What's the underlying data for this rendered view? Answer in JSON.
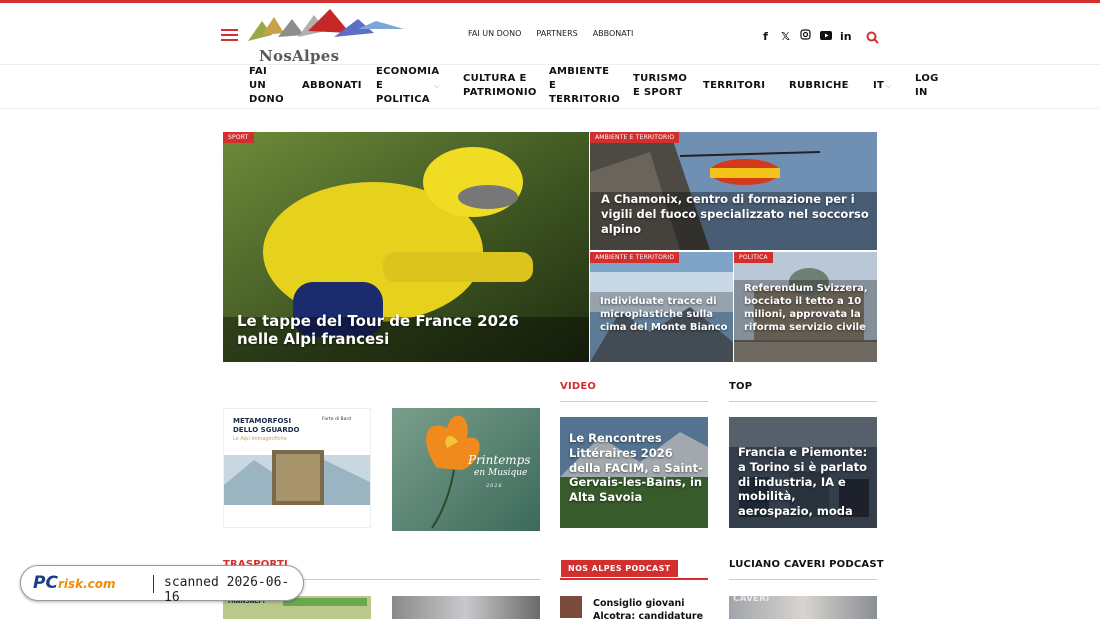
{
  "brand": {
    "name": "NosAlpes",
    "accent": "#d32f2f"
  },
  "toplinks": [
    "FAI UN DONO",
    "PARTNERS",
    "ABBONATI"
  ],
  "social_icons": [
    "facebook-icon",
    "x-icon",
    "instagram-icon",
    "youtube-icon",
    "linkedin-icon"
  ],
  "nav": {
    "fai": [
      "FAI",
      "UN",
      "DONO"
    ],
    "abbonati": "ABBONATI",
    "economia": [
      "ECONOMIA",
      "E",
      "POLITICA"
    ],
    "cultura": [
      "CULTURA E",
      "PATRIMONIO"
    ],
    "ambiente": [
      "AMBIENTE",
      "E",
      "TERRITORIO"
    ],
    "turismo": [
      "TURISMO",
      "E SPORT"
    ],
    "territori": "TERRITORI",
    "rubriche": "RUBRICHE",
    "lang": "IT",
    "login": [
      "LOG",
      "IN"
    ]
  },
  "hero": {
    "main": {
      "tag": "SPORT",
      "title": "Le tappe del Tour de France 2026 nelle Alpi francesi"
    },
    "top_right": {
      "tag": "AMBIENTE E TERRITORIO",
      "title": "A Chamonix, centro di formazione per i vigili del fuoco specializzato nel soccorso alpino"
    },
    "bottom_left": {
      "tag": "AMBIENTE E TERRITORIO",
      "title": "Individuate tracce di microplastiche sulla cima del Monte Bianco"
    },
    "bottom_right": {
      "tag": "POLITICA",
      "title": "Referendum Svizzera, bocciato il tetto a 10 milioni, approvata la riforma servizio civile"
    }
  },
  "ads": {
    "metamorfosi": {
      "title1": "METAMORFOSI",
      "title2": "DELLO SGUARDO",
      "subtitle": "Le Alpi immaginifiche",
      "place": "Forte di Bard"
    },
    "printemps": {
      "line1": "Printemps",
      "line2": "en Musique",
      "year": "2026"
    }
  },
  "sections": {
    "video": "VIDEO",
    "top": "TOP",
    "trasporti": "TRASPORTI",
    "podcast": "NOS ALPES PODCAST",
    "caveri": "LUCIANO CAVERI PODCAST"
  },
  "video_card": {
    "title": "Le Rencontres Littéraires 2026 della FACIM, a Saint-Gervais-les-Bains, in Alta Savoia"
  },
  "top_card": {
    "title": "Francia e Piemonte: a Torino si è parlato di industria, IA e mobilità, aerospazio, moda"
  },
  "podcast_item": {
    "title": "Consiglio giovani Alcotra: candidature"
  },
  "trasporti_thumb": {
    "label": "TRANSALPI"
  },
  "caveri_thumb": {
    "label": "CAVERI"
  },
  "watermark": {
    "site": "PC",
    "domain": "risk.com",
    "text": "scanned 2026-06-16"
  }
}
